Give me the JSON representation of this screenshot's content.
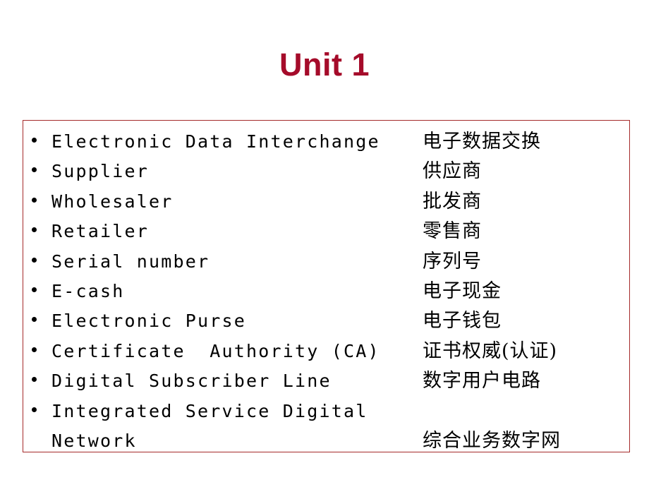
{
  "slide": {
    "title": "Unit 1",
    "title_color": "#a50b2a",
    "border_color": "#a52a2a",
    "background_color": "#ffffff",
    "text_color": "#000000",
    "bullet_glyph": "bullet-dot-icon"
  },
  "terms": [
    {
      "en": "Electronic Data Interchange",
      "zh": "电子数据交换",
      "en_line2": "",
      "wrapped": false
    },
    {
      "en": "Supplier",
      "zh": "供应商",
      "en_line2": "",
      "wrapped": false
    },
    {
      "en": "Wholesaler",
      "zh": "批发商",
      "en_line2": "",
      "wrapped": false
    },
    {
      "en": "Retailer",
      "zh": "零售商",
      "en_line2": "",
      "wrapped": false
    },
    {
      "en": "Serial number",
      "zh": "序列号",
      "en_line2": "",
      "wrapped": false
    },
    {
      "en": "E-cash",
      "zh": "电子现金",
      "en_line2": "",
      "wrapped": false
    },
    {
      "en": "Electronic Purse",
      "zh": "电子钱包",
      "en_line2": "",
      "wrapped": false
    },
    {
      "en": "Certificate  Authority (CA)",
      "zh": "证书权威(认证)",
      "en_line2": "",
      "wrapped": false
    },
    {
      "en": "Digital Subscriber Line",
      "zh": "数字用户电路",
      "en_line2": "",
      "wrapped": false
    },
    {
      "en": "Integrated Service Digital",
      "zh": "综合业务数字网",
      "en_line2": "Network",
      "wrapped": true
    }
  ]
}
